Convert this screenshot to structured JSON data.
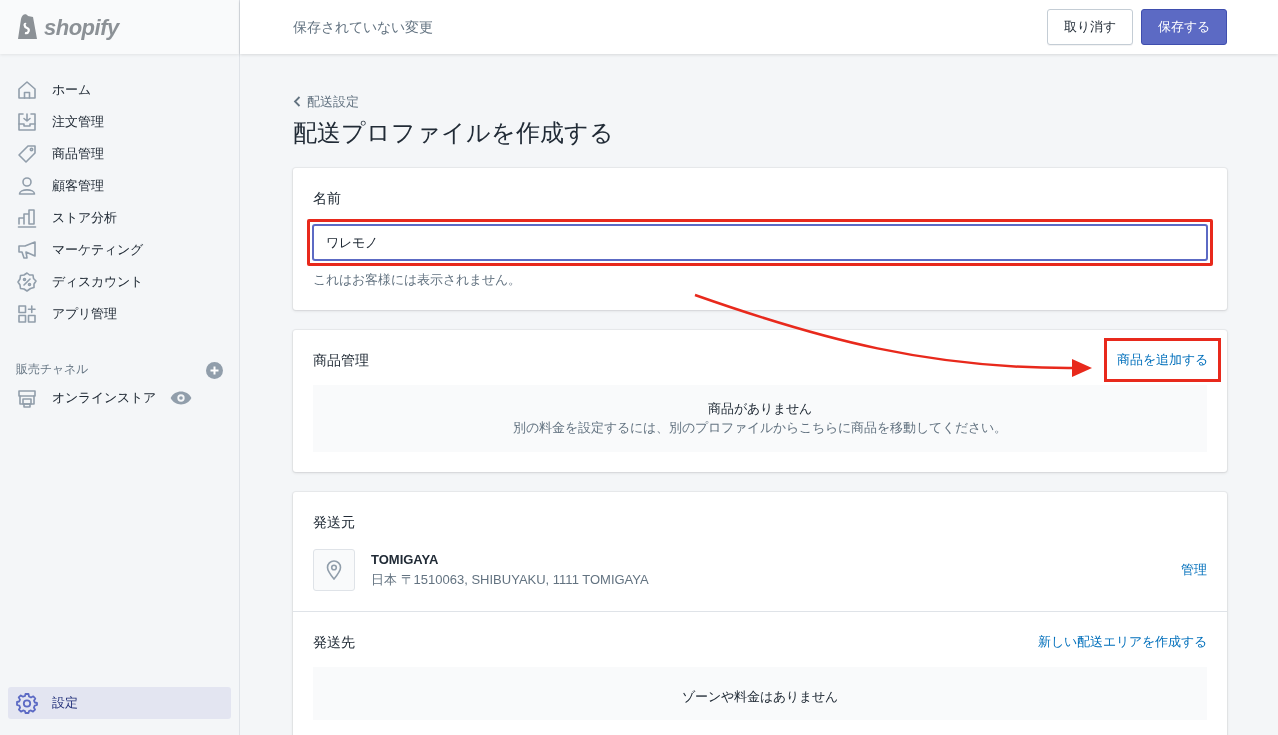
{
  "logo": {
    "text": "shopify"
  },
  "topbar": {
    "message": "保存されていない変更",
    "buttons": [
      {
        "label": "取り消す",
        "kind": "secondary"
      },
      {
        "label": "保存する",
        "kind": "primary"
      }
    ]
  },
  "sidebar": {
    "items": [
      {
        "label": "ホーム",
        "selected": false
      },
      {
        "label": "注文管理",
        "selected": false
      },
      {
        "label": "商品管理",
        "selected": false
      },
      {
        "label": "顧客管理",
        "selected": false
      },
      {
        "label": "ストア分析",
        "selected": false
      },
      {
        "label": "マーケティング",
        "selected": false
      },
      {
        "label": "ディスカウント",
        "selected": false
      },
      {
        "label": "アプリ管理",
        "selected": false
      }
    ],
    "channels_heading": "販売チャネル",
    "channels": [
      {
        "label": "オンラインストア",
        "selected": false
      }
    ],
    "settings": {
      "label": "設定",
      "selected": true
    }
  },
  "breadcrumb": "配送設定",
  "title": "配送プロファイルを作成する",
  "name_card": {
    "label": "名前",
    "value": "ワレモノ",
    "help": "これはお客様には表示されません。",
    "highlighted": true
  },
  "products_card": {
    "title": "商品管理",
    "action": "商品を追加する",
    "action_highlighted": true,
    "empty_title": "商品がありません",
    "empty_text": "別の料金を設定するには、別のプロファイルからこちらに商品を移動してください。"
  },
  "origin_card": {
    "title": "発送元",
    "location_name": "TOMIGAYA",
    "address": "日本 〒1510063, SHIBUYAKU, 1111 TOMIGAYA",
    "action": "管理"
  },
  "destination": {
    "title": "発送先",
    "action": "新しい配送エリアを作成する",
    "empty_title": "ゾーンや料金はありません"
  }
}
